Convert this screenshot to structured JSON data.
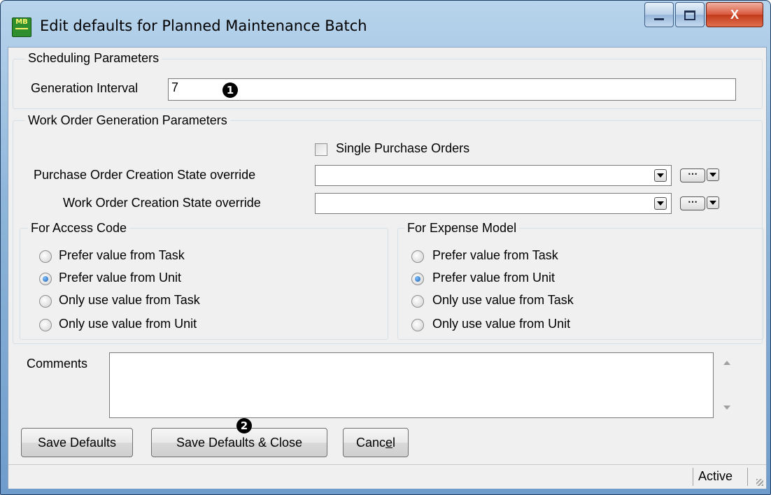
{
  "window": {
    "title": "Edit defaults for Planned Maintenance Batch",
    "icon_text_top": "MB",
    "icon_text_bottom": "",
    "minimize_icon": "minimize-icon",
    "maximize_icon": "maximize-icon",
    "close_icon": "close-icon",
    "close_glyph": "X"
  },
  "scheduling": {
    "legend": "Scheduling Parameters",
    "interval_label": "Generation Interval",
    "interval_value": "7"
  },
  "markers": {
    "one": "1",
    "two": "2"
  },
  "work_order": {
    "legend": "Work Order Generation Parameters",
    "single_po_label": "Single Purchase Orders",
    "single_po_checked": false,
    "po_state_label": "Purchase Order Creation State override",
    "po_state_value": "",
    "wo_state_label": "Work Order Creation State override",
    "wo_state_value": "",
    "ellipsis": "⋯"
  },
  "access_code": {
    "legend": "For Access Code",
    "options": [
      {
        "label": "Prefer value from Task",
        "checked": false
      },
      {
        "label": "Prefer value from Unit",
        "checked": true
      },
      {
        "label": "Only use value from Task",
        "checked": false
      },
      {
        "label": "Only use value from Unit",
        "checked": false
      }
    ]
  },
  "expense_model": {
    "legend": "For Expense Model",
    "options": [
      {
        "label": "Prefer value from Task",
        "checked": false
      },
      {
        "label": "Prefer value from Unit",
        "checked": true
      },
      {
        "label": "Only use value from Task",
        "checked": false
      },
      {
        "label": "Only use value from Unit",
        "checked": false
      }
    ]
  },
  "comments": {
    "label": "Comments",
    "value": ""
  },
  "buttons": {
    "save_defaults": "Save Defaults",
    "save_defaults_close": "Save Defaults & Close",
    "cancel_pre": "Canc",
    "cancel_mnemonic": "e",
    "cancel_post": "l"
  },
  "status": {
    "state": "Active"
  },
  "colors": {
    "title_gradient_top": "#b8d4ec",
    "client_background": "#f0f0f0",
    "close_button": "#c23a1b"
  }
}
